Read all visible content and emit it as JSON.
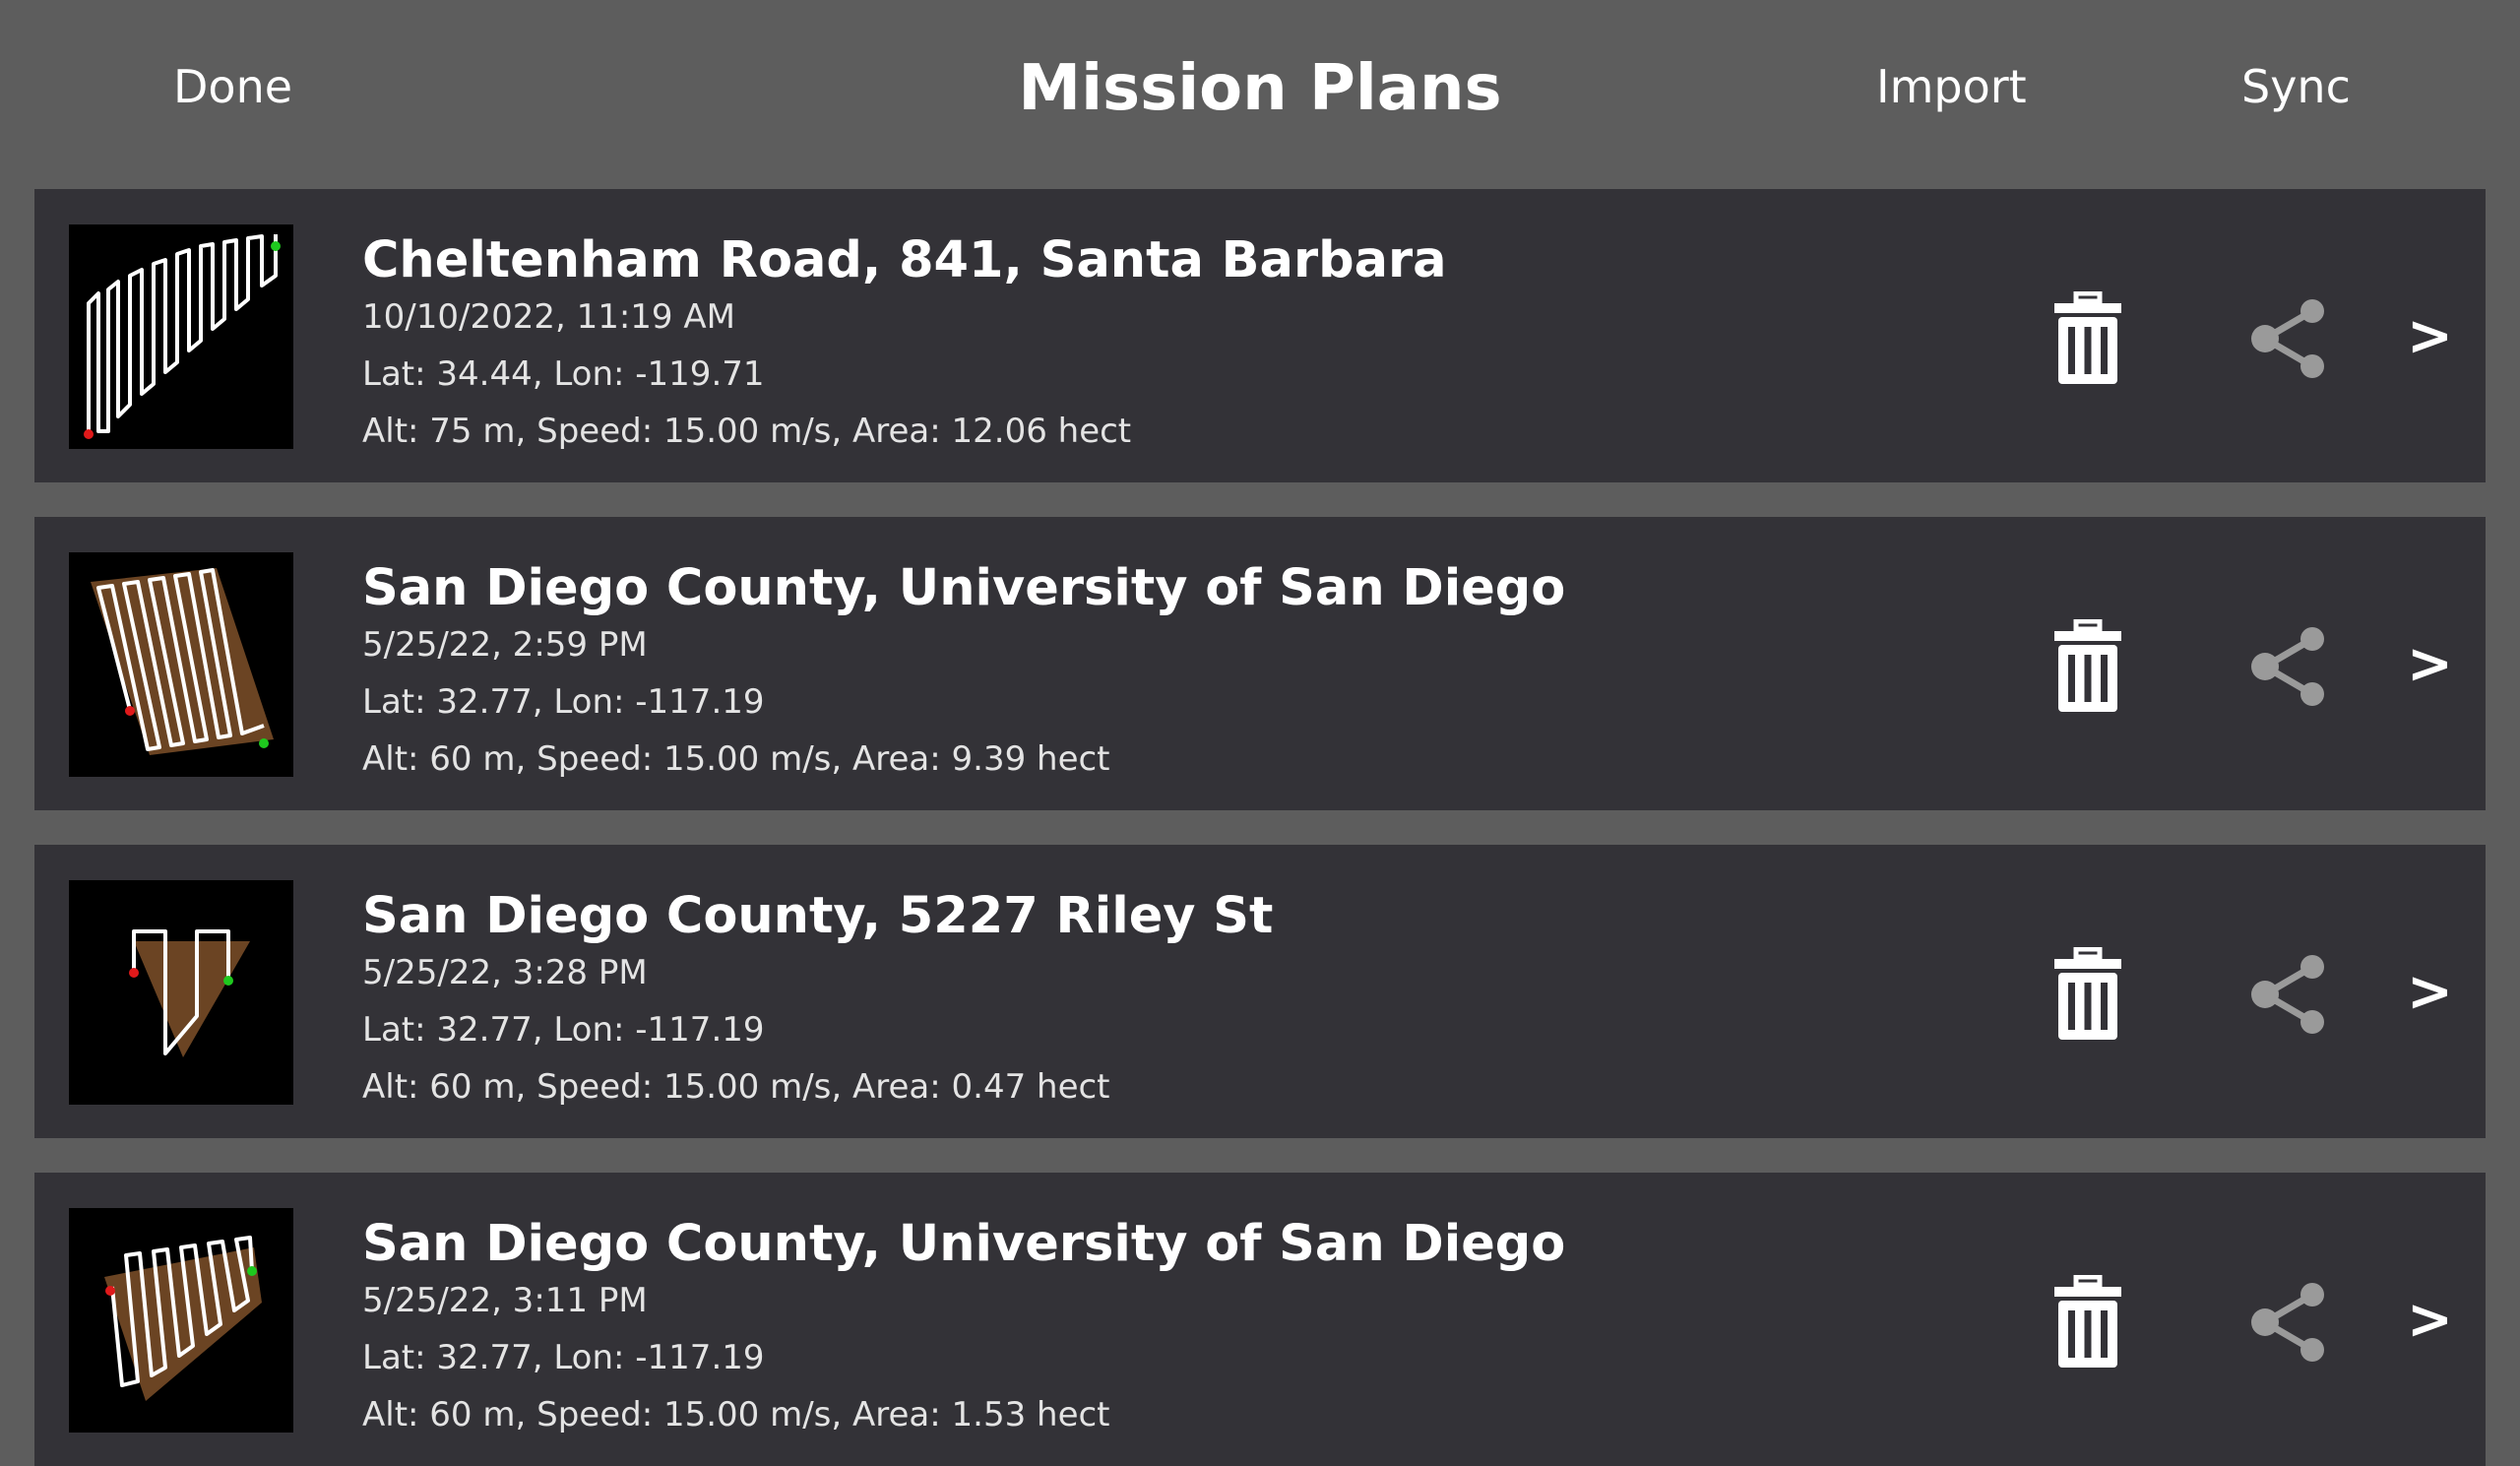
{
  "header": {
    "done_label": "Done",
    "title": "Mission Plans",
    "import_label": "Import",
    "sync_label": "Sync"
  },
  "missions": [
    {
      "title": "Cheltenham Road, 841, Santa Barbara",
      "datetime": "10/10/2022, 11:19 AM",
      "coords": "Lat: 34.44, Lon: -119.71",
      "stats": "Alt: 75 m, Speed: 15.00 m/s, Area: 12.06 hect",
      "chevron": ">"
    },
    {
      "title": "San Diego County, University of San Diego",
      "datetime": "5/25/22, 2:59 PM",
      "coords": "Lat: 32.77, Lon: -117.19",
      "stats": "Alt: 60 m, Speed: 15.00 m/s, Area: 9.39 hect",
      "chevron": ">"
    },
    {
      "title": "San Diego County, 5227 Riley St",
      "datetime": "5/25/22, 3:28 PM",
      "coords": "Lat: 32.77, Lon: -117.19",
      "stats": "Alt: 60 m, Speed: 15.00 m/s, Area: 0.47 hect",
      "chevron": ">"
    },
    {
      "title": "San Diego County, University of San Diego",
      "datetime": "5/25/22, 3:11 PM",
      "coords": "Lat: 32.77, Lon: -117.19",
      "stats": "Alt: 60 m, Speed: 15.00 m/s, Area: 1.53 hect",
      "chevron": ">"
    }
  ],
  "icons": {
    "trash": "trash-icon",
    "share": "share-icon",
    "chevron": "chevron-right-icon"
  },
  "colors": {
    "background": "#5d5d5d",
    "card": "#333237",
    "area_fill": "#6b4423",
    "path": "#ffffff",
    "start_marker": "#e0191a",
    "end_marker": "#1ec91e",
    "share_icon": "#9a9a9a"
  }
}
